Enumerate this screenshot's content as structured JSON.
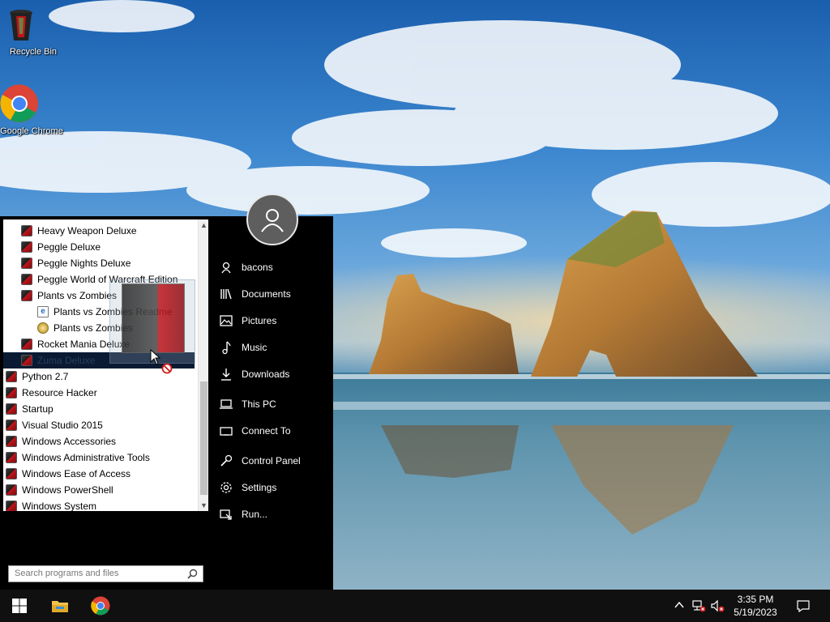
{
  "desktop": {
    "icons": [
      {
        "label": "Recycle Bin",
        "icon": "recycle-bin-icon"
      },
      {
        "label": "Google Chrome",
        "icon": "chrome-icon"
      }
    ]
  },
  "start_menu": {
    "programs": [
      {
        "label": "Heavy Weapon Deluxe",
        "icon": "game-box-icon",
        "level": 1
      },
      {
        "label": "Peggle Deluxe",
        "icon": "game-box-icon",
        "level": 1
      },
      {
        "label": "Peggle Nights Deluxe",
        "icon": "game-box-icon",
        "level": 1
      },
      {
        "label": "Peggle World of Warcraft Edition",
        "icon": "game-box-icon",
        "level": 1
      },
      {
        "label": "Plants vs Zombies",
        "icon": "game-box-icon",
        "level": 1
      },
      {
        "label": "Plants vs Zombies Readme",
        "icon": "document-icon",
        "level": 2
      },
      {
        "label": "Plants vs Zombies",
        "icon": "help-icon",
        "level": 2
      },
      {
        "label": "Rocket Mania Deluxe",
        "icon": "game-box-icon",
        "level": 1
      },
      {
        "label": "Zuma Deluxe",
        "icon": "game-box-icon",
        "level": 1,
        "selected": true
      },
      {
        "label": "Python 2.7",
        "icon": "folder-box-icon",
        "level": 0
      },
      {
        "label": "Resource Hacker",
        "icon": "folder-box-icon",
        "level": 0
      },
      {
        "label": "Startup",
        "icon": "folder-box-icon",
        "level": 0
      },
      {
        "label": "Visual Studio 2015",
        "icon": "folder-box-icon",
        "level": 0
      },
      {
        "label": "Windows Accessories",
        "icon": "folder-box-icon",
        "level": 0
      },
      {
        "label": "Windows Administrative Tools",
        "icon": "folder-box-icon",
        "level": 0
      },
      {
        "label": "Windows Ease of Access",
        "icon": "folder-box-icon",
        "level": 0
      },
      {
        "label": "Windows PowerShell",
        "icon": "folder-box-icon",
        "level": 0
      },
      {
        "label": "Windows System",
        "icon": "folder-box-icon",
        "level": 0
      }
    ],
    "search_placeholder": "Search programs and files",
    "right_items": [
      {
        "label": "bacons",
        "icon": "user-folder-icon"
      },
      {
        "label": "Documents",
        "icon": "documents-icon"
      },
      {
        "label": "Pictures",
        "icon": "pictures-icon"
      },
      {
        "label": "Music",
        "icon": "music-icon"
      },
      {
        "label": "Downloads",
        "icon": "downloads-icon"
      },
      {
        "label": "This PC",
        "icon": "computer-icon"
      },
      {
        "label": "Connect To",
        "icon": "connect-icon"
      },
      {
        "label": "Control Panel",
        "icon": "control-panel-icon"
      },
      {
        "label": "Settings",
        "icon": "gear-icon"
      },
      {
        "label": "Run...",
        "icon": "run-icon"
      }
    ]
  },
  "taskbar": {
    "time": "3:35 PM",
    "date": "5/19/2023"
  },
  "colors": {
    "menu_bg": "#000000",
    "taskbar_bg": "#101010",
    "selection": "#0a1a33"
  }
}
